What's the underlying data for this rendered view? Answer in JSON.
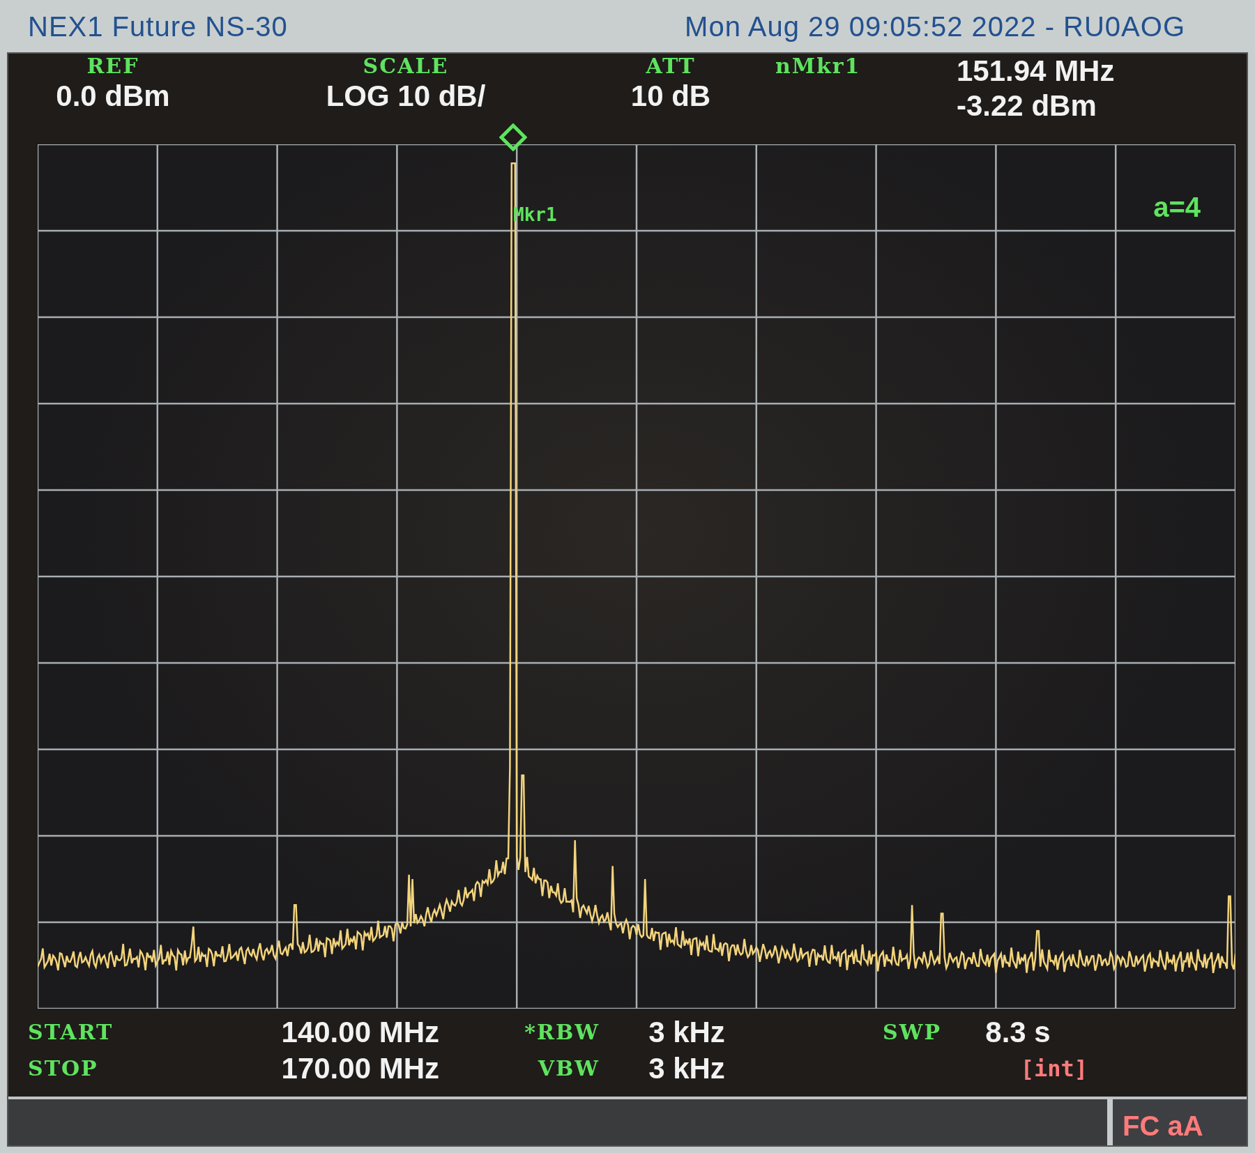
{
  "title_bar": {
    "instrument": "NEX1 Future NS-30",
    "datetime": "Mon Aug 29 09:05:52 2022 - RU0AOG"
  },
  "header": [
    {
      "label": "REF",
      "value": "0.0 dBm"
    },
    {
      "label": "SCALE",
      "value": "LOG 10 dB/"
    },
    {
      "label": "ATT",
      "value": "10 dB"
    }
  ],
  "marker_readout": {
    "label": "nMkr1",
    "frequency": "151.94 MHz",
    "amplitude": "-3.22 dBm"
  },
  "plot": {
    "marker_label": "Mkr1",
    "averaging": "a=4"
  },
  "footer": [
    [
      {
        "label": "START",
        "value": "140.00 MHz"
      },
      {
        "label": "STOP",
        "value": "170.00 MHz"
      }
    ],
    [
      {
        "label": "*RBW",
        "value": "3 kHz"
      },
      {
        "label": "VBW",
        "value": "3 kHz"
      }
    ],
    [
      {
        "label": "SWP",
        "value": "8.3 s"
      },
      {
        "note": "[int]"
      }
    ]
  ],
  "status": "FC aA"
}
